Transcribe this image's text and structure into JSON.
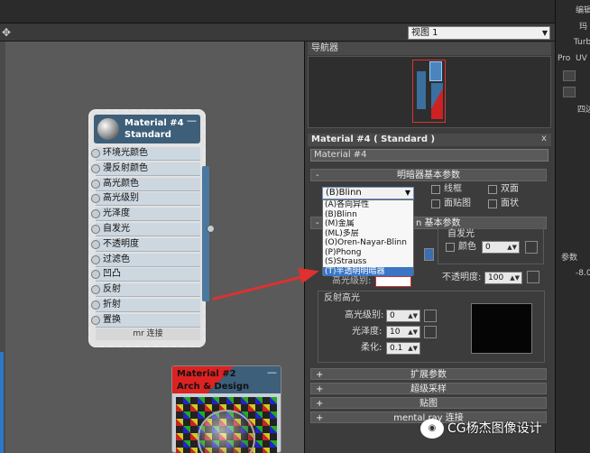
{
  "toolbar": {
    "view_select": "视图 1"
  },
  "navigator": {
    "title": "导航器"
  },
  "node": {
    "title_line1": "Material #4",
    "title_line2": "Standard",
    "minimize": "—",
    "slots": [
      "环境光颜色",
      "漫反射颜色",
      "高光颜色",
      "高光级别",
      "光泽度",
      "自发光",
      "不透明度",
      "过滤色",
      "凹凸",
      "反射",
      "折射",
      "置换"
    ],
    "footer": "mr 连接"
  },
  "node2": {
    "title_line1": "Material #2",
    "title_line2": "Arch & Design",
    "minimize": "—"
  },
  "material_panel": {
    "title": "Material #4 ( Standard )",
    "close": "x",
    "name": "Material #4",
    "shader_rollout": "明暗器基本参数",
    "shader_selected": "(B)Blinn",
    "checkboxes": [
      "线框",
      "双面",
      "面贴图",
      "面状"
    ],
    "shader_options": [
      "(A)各向异性",
      "(B)Blinn",
      "(M)金属",
      "(ML)多层",
      "(O)Oren-Nayar-Blinn",
      "(P)Phong",
      "(S)Strauss",
      "(T)半透明明暗器"
    ],
    "selected_index": 7,
    "basic_params_suffix": "n 基本参数",
    "self_illum_title": "自发光",
    "color_label": "颜色",
    "color_value": "0",
    "opacity_label": "不透明度:",
    "opacity_value": "100",
    "spec_level_hidden_label": "高光级别:",
    "spec_box_title": "反射高光",
    "spec_level_label": "高光级别:",
    "spec_level_value": "0",
    "gloss_label": "光泽度:",
    "gloss_value": "10",
    "soften_label": "柔化:",
    "soften_value": "0.1",
    "rollouts": [
      "扩展参数",
      "超级采样",
      "贴图",
      "mental ray 连接"
    ],
    "rollout_sign": "+",
    "collapse_sign": "-"
  },
  "side": {
    "items": [
      "编辑",
      "玛",
      "Turb",
      "Pro",
      "UV",
      "四边"
    ],
    "params": "参数",
    "params_value": "-8.0"
  },
  "watermark": {
    "text": "CG杨杰图像设计"
  }
}
